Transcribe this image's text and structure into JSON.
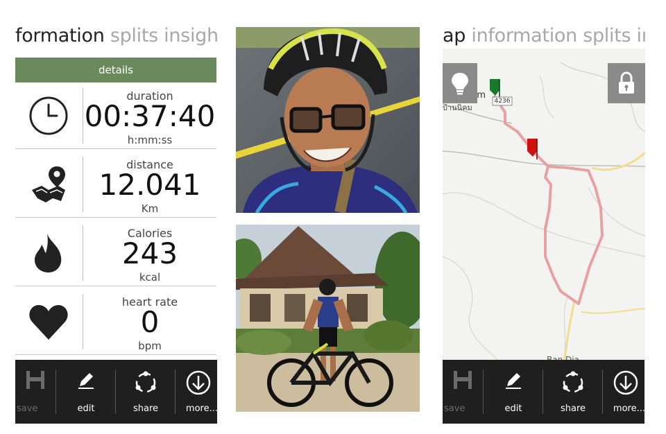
{
  "left": {
    "pivot": {
      "active": "formation",
      "inactive": "splits insight r"
    },
    "details_label": "details",
    "stats": [
      {
        "icon": "clock-icon",
        "label": "duration",
        "value": "00:37:40",
        "unit": "h:mm:ss"
      },
      {
        "icon": "map-pin-icon",
        "label": "distance",
        "value": "12.041",
        "unit": "Km"
      },
      {
        "icon": "flame-icon",
        "label": "Calories",
        "value": "243",
        "unit": "kcal"
      },
      {
        "icon": "heart-icon",
        "label": "heart rate",
        "value": "0",
        "unit": "bpm"
      }
    ],
    "appbar": {
      "save": "save",
      "edit": "edit",
      "share": "share",
      "more": "more..."
    }
  },
  "right": {
    "pivot": {
      "active": "ap",
      "inactive": "information splits ins"
    },
    "map": {
      "place_label": "n Nikhom",
      "place_label_thai": "บ้านนิคม",
      "road_number": "4236",
      "bottom_label": "Ban Dia"
    },
    "appbar": {
      "save": "save",
      "edit": "edit",
      "share": "share",
      "more": "more..."
    }
  },
  "colors": {
    "accent_green": "#6a8a5e",
    "appbar_bg": "#1f1f1f",
    "route_color": "#e9a0a0",
    "start_flag": "#1a7a2a",
    "end_flag": "#cc1111"
  }
}
